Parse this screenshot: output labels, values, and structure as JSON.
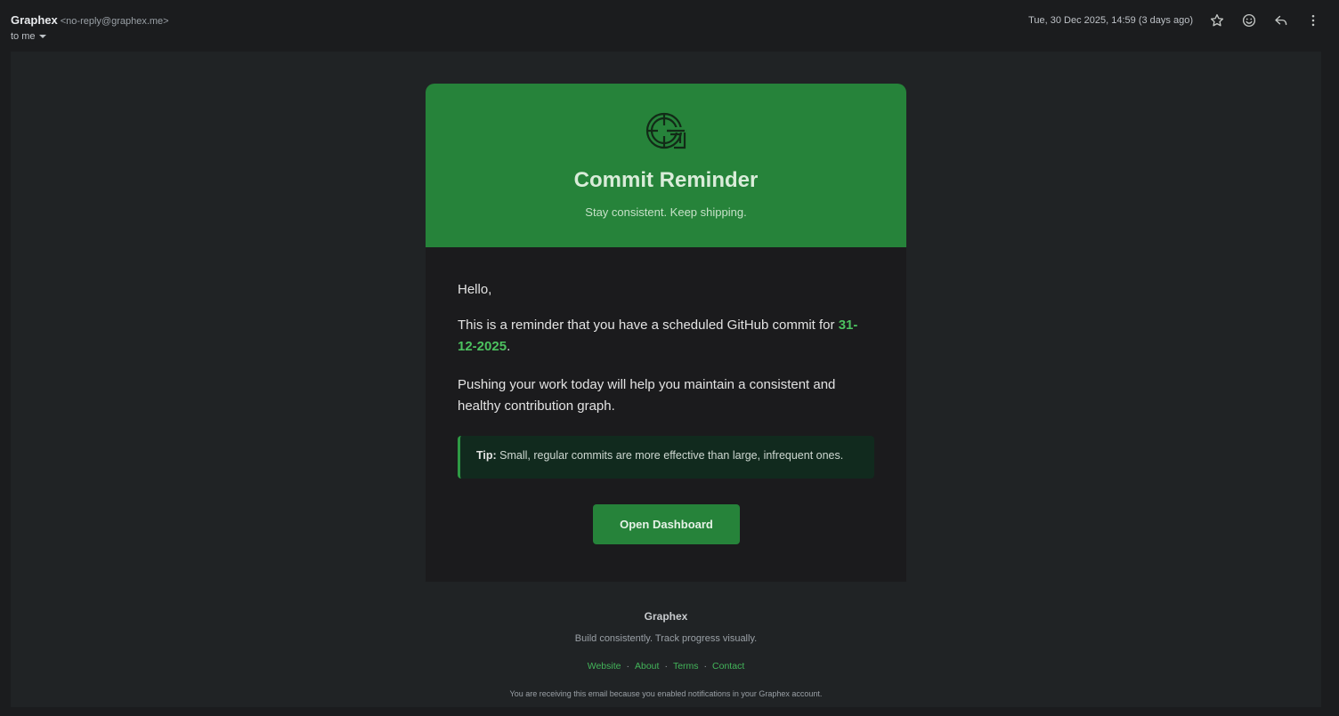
{
  "mail": {
    "sender_name": "Graphex",
    "sender_email": "<no-reply@graphex.me>",
    "recipient": "to me",
    "date": "Tue, 30 Dec 2025, 14:59 (3 days ago)",
    "actions": [
      {
        "icon": "star-icon"
      },
      {
        "icon": "emoji-icon"
      },
      {
        "icon": "reply-icon"
      },
      {
        "icon": "more-vert-icon"
      }
    ]
  },
  "email": {
    "header": {
      "logo_icon": "graphex-logo",
      "title": "Commit Reminder",
      "subtitle": "Stay consistent. Keep shipping.",
      "color": "#26833a"
    },
    "body": {
      "greeting": "Hello,",
      "reminder_prefix": "This is a reminder that you have a scheduled GitHub commit for ",
      "reminder_date": "31-12-2025",
      "reminder_suffix": ".",
      "paragraph2": "Pushing your work today will help you maintain a consistent and healthy contribution graph.",
      "tip_label": "Tip:",
      "tip_text": " Small, regular commits are more effective than large, infrequent ones.",
      "button_label": "Open Dashboard"
    },
    "footer": {
      "brand": "Graphex",
      "tagline": "Build consistently. Track progress visually.",
      "links": [
        "Website",
        "About",
        "Terms",
        "Contact"
      ],
      "separator": "·",
      "note": "You are receiving this email because you enabled notifications in your Graphex account."
    }
  },
  "colors": {
    "accent_green": "#26833a",
    "link_green": "#43b55a",
    "background": "#1b1c1e"
  }
}
